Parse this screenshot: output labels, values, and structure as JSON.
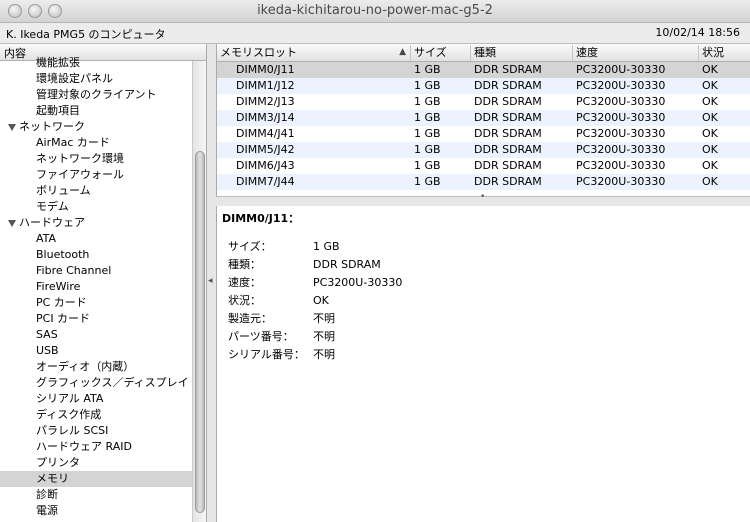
{
  "window": {
    "title": "ikeda-kichitarou-no-power-mac-g5-2"
  },
  "infobar": {
    "computer_name": "K. Ikeda PMG5 のコンピュータ",
    "datetime": "10/02/14 18:56"
  },
  "sidebar": {
    "header": "内容",
    "items": [
      {
        "label": "機能拡張",
        "level": 1
      },
      {
        "label": "環境設定パネル",
        "level": 1
      },
      {
        "label": "管理対象のクライアント",
        "level": 1
      },
      {
        "label": "起動項目",
        "level": 1
      },
      {
        "label": "ネットワーク",
        "level": 0
      },
      {
        "label": "AirMac カード",
        "level": 1
      },
      {
        "label": "ネットワーク環境",
        "level": 1
      },
      {
        "label": "ファイアウォール",
        "level": 1
      },
      {
        "label": "ボリューム",
        "level": 1
      },
      {
        "label": "モデム",
        "level": 1
      },
      {
        "label": "ハードウェア",
        "level": 0
      },
      {
        "label": "ATA",
        "level": 1
      },
      {
        "label": "Bluetooth",
        "level": 1
      },
      {
        "label": "Fibre Channel",
        "level": 1
      },
      {
        "label": "FireWire",
        "level": 1
      },
      {
        "label": "PC カード",
        "level": 1
      },
      {
        "label": "PCI カード",
        "level": 1
      },
      {
        "label": "SAS",
        "level": 1
      },
      {
        "label": "USB",
        "level": 1
      },
      {
        "label": "オーディオ（内蔵）",
        "level": 1
      },
      {
        "label": "グラフィックス／ディスプレイ",
        "level": 1
      },
      {
        "label": "シリアル ATA",
        "level": 1
      },
      {
        "label": "ディスク作成",
        "level": 1
      },
      {
        "label": "パラレル SCSI",
        "level": 1
      },
      {
        "label": "ハードウェア RAID",
        "level": 1
      },
      {
        "label": "プリンタ",
        "level": 1
      },
      {
        "label": "メモリ",
        "level": 1,
        "selected": true
      },
      {
        "label": "診断",
        "level": 1
      },
      {
        "label": "電源",
        "level": 1
      }
    ]
  },
  "table": {
    "columns": [
      "メモリスロット",
      "サイズ",
      "種類",
      "速度",
      "状況"
    ],
    "rows": [
      [
        "DIMM0/J11",
        "1 GB",
        "DDR SDRAM",
        "PC3200U-30330",
        "OK"
      ],
      [
        "DIMM1/J12",
        "1 GB",
        "DDR SDRAM",
        "PC3200U-30330",
        "OK"
      ],
      [
        "DIMM2/J13",
        "1 GB",
        "DDR SDRAM",
        "PC3200U-30330",
        "OK"
      ],
      [
        "DIMM3/J14",
        "1 GB",
        "DDR SDRAM",
        "PC3200U-30330",
        "OK"
      ],
      [
        "DIMM4/J41",
        "1 GB",
        "DDR SDRAM",
        "PC3200U-30330",
        "OK"
      ],
      [
        "DIMM5/J42",
        "1 GB",
        "DDR SDRAM",
        "PC3200U-30330",
        "OK"
      ],
      [
        "DIMM6/J43",
        "1 GB",
        "DDR SDRAM",
        "PC3200U-30330",
        "OK"
      ],
      [
        "DIMM7/J44",
        "1 GB",
        "DDR SDRAM",
        "PC3200U-30330",
        "OK"
      ]
    ],
    "selected_row": 0
  },
  "detail": {
    "title": "DIMM0/J11：",
    "fields": [
      {
        "label": "サイズ：",
        "value": "1 GB"
      },
      {
        "label": "種類：",
        "value": "DDR SDRAM"
      },
      {
        "label": "速度：",
        "value": "PC3200U-30330"
      },
      {
        "label": "状況：",
        "value": "OK"
      },
      {
        "label": "製造元：",
        "value": "不明"
      },
      {
        "label": "パーツ番号：",
        "value": "不明"
      },
      {
        "label": "シリアル番号：",
        "value": "不明"
      }
    ]
  }
}
